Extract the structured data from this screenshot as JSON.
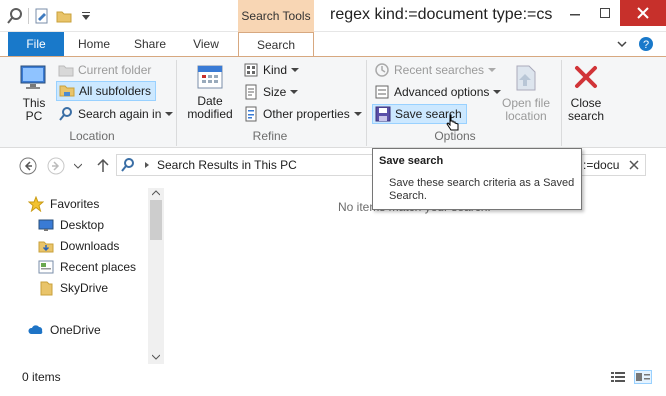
{
  "window": {
    "title": "regex kind:=document type:=cs",
    "context_tab": "Search Tools"
  },
  "tabs": [
    {
      "label": "File"
    },
    {
      "label": "Home"
    },
    {
      "label": "Share"
    },
    {
      "label": "View"
    },
    {
      "label": "Search"
    }
  ],
  "ribbon": {
    "location": {
      "label": "Location",
      "this_pc": "This PC",
      "current_folder": "Current folder",
      "all_subfolders": "All subfolders",
      "search_again_in": "Search again in"
    },
    "refine": {
      "label": "Refine",
      "date_modified": "Date modified",
      "kind": "Kind",
      "size": "Size",
      "other_properties": "Other properties"
    },
    "options": {
      "label": "Options",
      "recent_searches": "Recent searches",
      "advanced_options": "Advanced options",
      "save_search": "Save search",
      "open_file_location": "Open file location"
    },
    "close": {
      "close_search": "Close search"
    }
  },
  "address": {
    "path": "Search Results in This PC",
    "search_value": ":=docu"
  },
  "nav": {
    "favorites": "Favorites",
    "items": [
      "Desktop",
      "Downloads",
      "Recent places",
      "SkyDrive"
    ],
    "onedrive": "OneDrive"
  },
  "content": {
    "empty_message": "No items match your search."
  },
  "status": {
    "count": "0 items"
  },
  "tooltip": {
    "title": "Save search",
    "body": "Save these search criteria as a Saved Search."
  },
  "colors": {
    "file_tab": "#1979ca",
    "context_tab": "#f8d6b4",
    "close_button": "#c7302b",
    "selection": "#cce8ff"
  }
}
